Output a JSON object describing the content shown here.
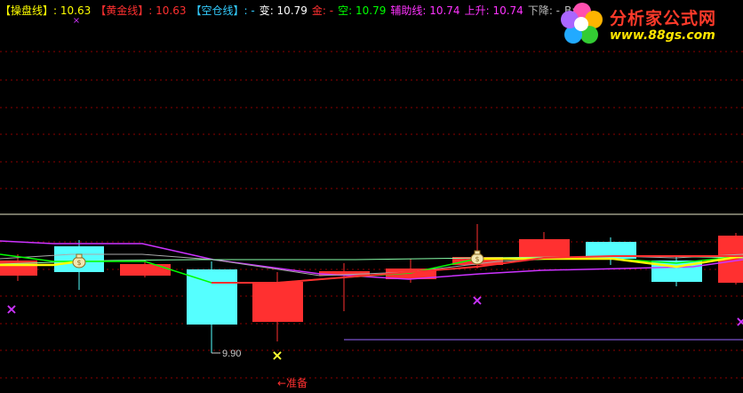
{
  "legend": {
    "items": [
      {
        "label": "【操盘线】",
        "value": ": 10.63",
        "color": "#ffff00"
      },
      {
        "label": "【黄金线】",
        "value": ": 10.63",
        "color": "#ff3030"
      },
      {
        "label": "【空仓线】",
        "value": ": -",
        "color": "#33ccff"
      },
      {
        "label": "变",
        "value": ": 10.79",
        "color": "#ffffff"
      },
      {
        "label": "金",
        "value": ": -",
        "color": "#ff3030"
      },
      {
        "label": "空",
        "value": ": 10.79",
        "color": "#00ff00"
      },
      {
        "label": "辅助线",
        "value": ": 10.74",
        "color": "#ff33ff"
      },
      {
        "label": "上升",
        "value": ": 10.74",
        "color": "#ff33ff"
      },
      {
        "label": "下降",
        "value": ": -",
        "color": "#bbbbbb"
      },
      {
        "label": "B",
        "value": ":",
        "color": "#bbbbbb"
      }
    ]
  },
  "watermark": {
    "title": "分析家公式网",
    "url": "www.88gs.com"
  },
  "chart": {
    "low_label": "9.90",
    "signal_label": "←准备",
    "colors": {
      "up": "#ff3030",
      "down": "#55ffff",
      "grid": "#8b0000",
      "ma_yellow": "#ffff00",
      "ma_green": "#00ff00",
      "ma_purple": "#cc33ff",
      "ma_gray": "#aaaaaa",
      "ma_lightgreen": "#88ffaa"
    }
  }
}
